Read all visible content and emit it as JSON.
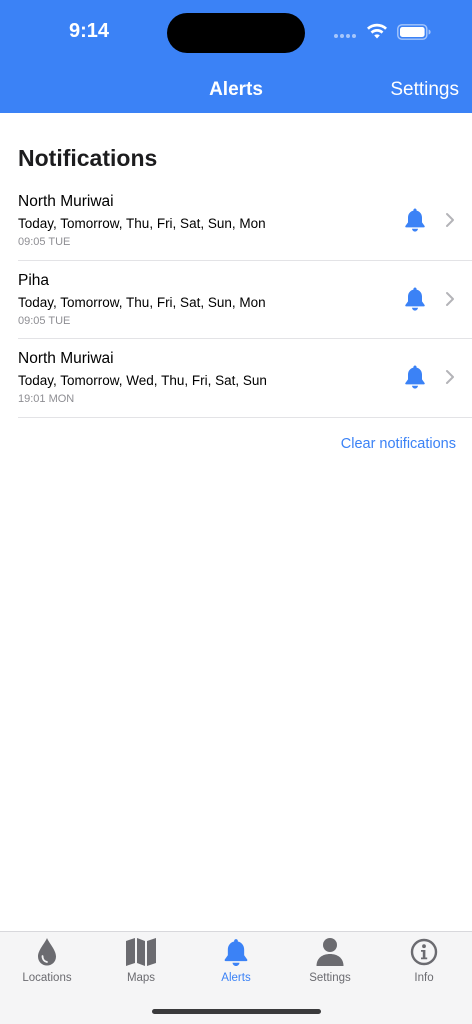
{
  "status_bar": {
    "time": "9:14"
  },
  "nav": {
    "title": "Alerts",
    "right_action": "Settings"
  },
  "section_title": "Notifications",
  "notifications": [
    {
      "location": "North Muriwai",
      "days": "Today, Tomorrow, Thu, Fri, Sat, Sun, Mon",
      "time": "09:05 TUE"
    },
    {
      "location": "Piha",
      "days": "Today, Tomorrow, Thu, Fri, Sat, Sun, Mon",
      "time": "09:05 TUE"
    },
    {
      "location": "North Muriwai",
      "days": "Today, Tomorrow, Wed, Thu, Fri, Sat, Sun",
      "time": "19:01 MON"
    }
  ],
  "clear_label": "Clear notifications",
  "tabs": [
    {
      "label": "Locations",
      "icon": "drop-icon",
      "active": false
    },
    {
      "label": "Maps",
      "icon": "map-icon",
      "active": false
    },
    {
      "label": "Alerts",
      "icon": "bell-icon",
      "active": true
    },
    {
      "label": "Settings",
      "icon": "person-icon",
      "active": false
    },
    {
      "label": "Info",
      "icon": "info-icon",
      "active": false
    }
  ],
  "colors": {
    "accent": "#3b82f6",
    "inactive": "#6b6b70",
    "separator": "#e3e3e6"
  }
}
